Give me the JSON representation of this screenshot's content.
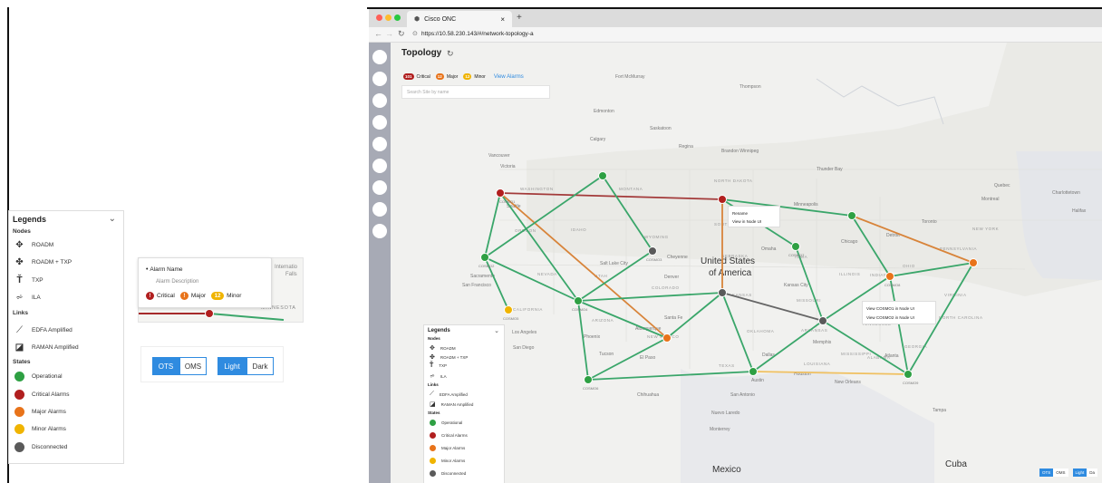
{
  "legend": {
    "title": "Legends",
    "sections": {
      "nodes": "Nodes",
      "links": "Links",
      "states": "States"
    },
    "nodes": [
      {
        "label": "ROADM",
        "icon": "roadm-icon"
      },
      {
        "label": "ROADM + TXP",
        "icon": "roadm-txp-icon"
      },
      {
        "label": "TXP",
        "icon": "txp-icon"
      },
      {
        "label": "ILA",
        "icon": "ila-icon"
      }
    ],
    "links": [
      {
        "label": "EDFA Amplified",
        "icon": "edfa-link-icon"
      },
      {
        "label": "RAMAN Amplified",
        "icon": "raman-link-icon"
      }
    ],
    "states": [
      {
        "label": "Operational",
        "color": "#2ea043"
      },
      {
        "label": "Critical Alarms",
        "color": "#b11f1f"
      },
      {
        "label": "Major Alarms",
        "color": "#e8731a"
      },
      {
        "label": "Minor Alarms",
        "color": "#f0b400"
      },
      {
        "label": "Disconnected",
        "color": "#5a5a5a"
      }
    ]
  },
  "alarm_card": {
    "name": "Alarm Name",
    "description": "Alarm Description",
    "critical": "Critical",
    "major": "Major",
    "minor": "Minor",
    "critical_badge": "!",
    "major_badge": "!",
    "minor_badge": "12",
    "map_label_1": "Internatio",
    "map_label_2": "Falls",
    "map_label_3": "MINNESOTA"
  },
  "toggles": {
    "ots": "OTS",
    "oms": "OMS",
    "light": "Light",
    "dark": "Dark"
  },
  "browser": {
    "tab_title": "Cisco ONC",
    "tab_close": "×",
    "new_tab": "+",
    "url": "https://10.58.230.143/#/network-topology-a"
  },
  "topology": {
    "title": "Topology",
    "refresh_icon": "refresh-icon",
    "alarm_counts": {
      "critical": "101",
      "major": "12",
      "minor": "12"
    },
    "alarm_labels": {
      "critical": "Critical",
      "major": "Major",
      "minor": "Minor"
    },
    "view_alarms": "View Alarms",
    "search_placeholder": "Search Site by name",
    "map_labels": {
      "us": "United States",
      "us2": "of America",
      "mexico": "Mexico",
      "cuba": "Cuba",
      "vancouver": "Vancouver",
      "victoria": "Victoria",
      "seattle": "Seattle",
      "calgary": "Calgary",
      "edmonton": "Edmonton",
      "saskatoon": "Saskatoon",
      "regina": "Regina",
      "winnipeg": "Brandon Winnipeg",
      "thompson": "Thompson",
      "fort_mcmurray": "Fort McMurray",
      "thunder_bay": "Thunder Bay",
      "toronto": "Toronto",
      "chicago": "Chicago",
      "detroit": "Detroit",
      "sacramento": "Sacramento",
      "san_francisco": "San Francisco",
      "los_angeles": "Los Angeles",
      "san_diego": "San Diego",
      "phoenix": "Phoenix",
      "tucson": "Tucson",
      "el_paso": "El Paso",
      "denver": "Denver",
      "salt_lake": "Salt Lake City",
      "cheyenne": "Cheyenne",
      "albuquerque": "Albuquerque",
      "santa_fe": "Santa Fe",
      "dallas": "Dallas",
      "austin": "Austin",
      "san_antonio": "San Antonio",
      "houston": "Houston",
      "new_orleans": "New Orleans",
      "memphis": "Memphis",
      "atlanta": "Atlanta",
      "tampa": "Tampa",
      "montreal": "Montreal",
      "quebec": "Quebec",
      "halifax": "Halifax",
      "charlottetown": "Charlottetown",
      "omaha": "Omaha",
      "kansas": "Kansas City",
      "minneapolis": "Minneapolis",
      "chihuahua": "Chihuahua",
      "monterrey": "Monterrey",
      "nuevo_laredo": "Nuevo Laredo",
      "washington": "WASHINGTON",
      "montana": "MONTANA",
      "oregon": "OREGON",
      "idaho": "IDAHO",
      "wyoming": "WYOMING",
      "nevada": "NEVADA",
      "utah": "UTAH",
      "colorado": "COLORADO",
      "california": "CALIFORNIA",
      "arizona": "ARIZONA",
      "new_mexico": "NEW MEXICO",
      "texas": "TEXAS",
      "oklahoma": "OKLAHOMA",
      "north_dakota": "NORTH DAKOTA",
      "south_dakota": "SOUTH DAKOTA",
      "nebraska": "NEBRASKA",
      "kansas_st": "KANSAS",
      "iowa": "IOWA",
      "missouri": "MISSOURI",
      "illinois": "ILLINOIS",
      "indiana": "INDIANA",
      "ohio": "OHIO",
      "kentucky": "KENTUCKY",
      "tennessee": "TENNESSEE",
      "georgia": "GEORGIA",
      "pennsylvania": "PENNSYLVANIA",
      "new_york": "NEW YORK",
      "virginia": "VIRGINIA",
      "carolina": "NORTH CAROLINA",
      "mississippi": "MISSISSIPPI",
      "louisiana": "LOUISIANA",
      "alabama": "ALABAMA",
      "arkansas": "ARKANSAS"
    },
    "node_labels": {
      "n1": "COSMO1",
      "n2": "COSMO2",
      "n3": "COSMO3",
      "n4": "COSMO4",
      "n5": "COSMO5",
      "n6": "COSMO6",
      "n7": "COSMO7",
      "n8": "COSMO8",
      "n9": "COSMO9"
    },
    "context_menu": {
      "item1": "Rename",
      "item2": "View in Node UI"
    },
    "context_menu2": {
      "item1": "View COSMO1 in Node UI",
      "item2": "View COSMO2 in Node UI"
    },
    "bottom_toggles": {
      "ots": "OTS",
      "oms": "OMS",
      "light": "Light",
      "dark": "Da"
    }
  },
  "map_legend": {
    "title": "Legends",
    "nodes_title": "Nodes",
    "links_title": "Links",
    "states_title": "States",
    "items": [
      "ROADM",
      "ROADM + TXP",
      "TXP",
      "ILA",
      "EDFA Amplified",
      "RAMAN Amplified",
      "Operational",
      "Critical Alarms",
      "Major Alarms",
      "Minor Alarms",
      "Disconnected"
    ]
  }
}
